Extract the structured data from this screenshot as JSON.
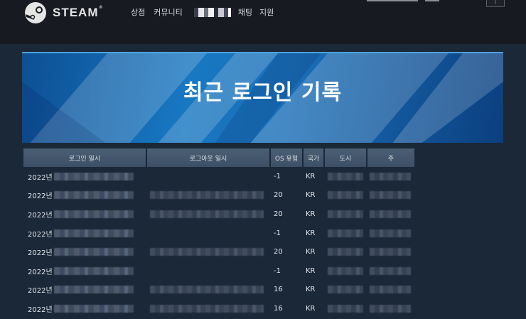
{
  "header": {
    "logo_text": "STEAM",
    "logo_tm": "®",
    "nav": {
      "store": "상점",
      "community": "커뮤니티",
      "chat": "채팅",
      "support": "지원"
    },
    "menu_glyph": "⁝"
  },
  "banner": {
    "title": "최근 로그인 기록"
  },
  "table": {
    "columns": {
      "login": "로그인 일시",
      "logout": "로그아웃 일시",
      "os": "OS 유형",
      "country": "국가",
      "city": "도시",
      "state": "주"
    },
    "rows": [
      {
        "year": "2022년",
        "os": "-1",
        "country": "KR",
        "logout_hidden": false
      },
      {
        "year": "2022년",
        "os": "20",
        "country": "KR",
        "logout_hidden": true
      },
      {
        "year": "2022년",
        "os": "20",
        "country": "KR",
        "logout_hidden": true
      },
      {
        "year": "2022년",
        "os": "-1",
        "country": "KR",
        "logout_hidden": false
      },
      {
        "year": "2022년",
        "os": "20",
        "country": "KR",
        "logout_hidden": true
      },
      {
        "year": "2022년",
        "os": "-1",
        "country": "KR",
        "logout_hidden": false
      },
      {
        "year": "2022년",
        "os": "16",
        "country": "KR",
        "logout_hidden": true
      },
      {
        "year": "2022년",
        "os": "16",
        "country": "KR",
        "logout_hidden": true
      }
    ]
  }
}
